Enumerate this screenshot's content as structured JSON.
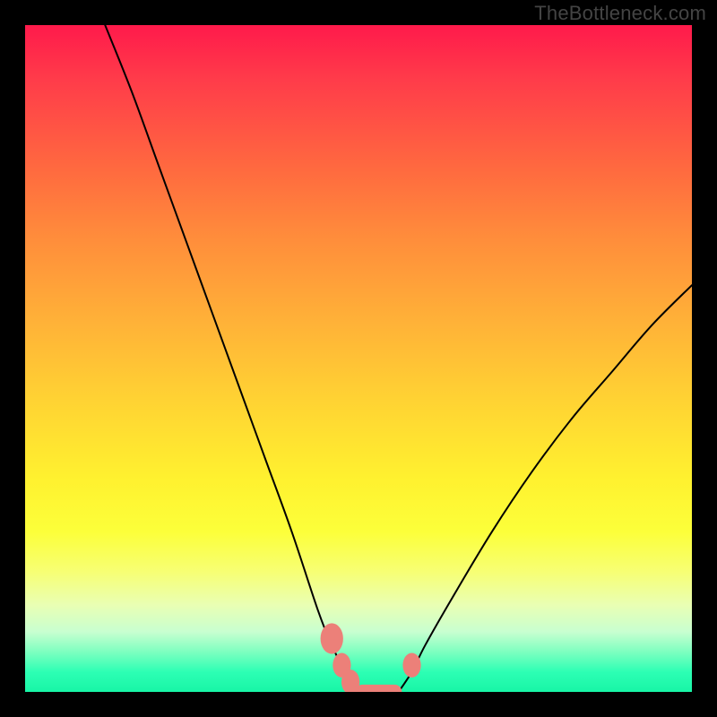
{
  "watermark": "TheBottleneck.com",
  "chart_data": {
    "type": "line",
    "title": "",
    "xlabel": "",
    "ylabel": "",
    "xlim": [
      0,
      100
    ],
    "ylim": [
      0,
      100
    ],
    "grid": false,
    "series": [
      {
        "name": "left-curve",
        "stroke": "#000000",
        "x": [
          12,
          16,
          20,
          24,
          28,
          32,
          36,
          40,
          44,
          46,
          48,
          50
        ],
        "y": [
          100,
          90,
          79,
          68,
          57,
          46,
          35,
          24,
          12,
          7,
          3,
          0
        ]
      },
      {
        "name": "right-curve",
        "stroke": "#000000",
        "x": [
          56,
          58,
          60,
          64,
          70,
          76,
          82,
          88,
          94,
          100
        ],
        "y": [
          0,
          3,
          7,
          14,
          24,
          33,
          41,
          48,
          55,
          61
        ]
      },
      {
        "name": "bottom-flat",
        "stroke": "#000000",
        "x": [
          50,
          56
        ],
        "y": [
          0,
          0
        ]
      }
    ],
    "markers": [
      {
        "name": "marker-left-upper",
        "x": 46.0,
        "y": 8.0,
        "r": 2.0,
        "color": "#ec8079"
      },
      {
        "name": "marker-left-mid",
        "x": 47.5,
        "y": 4.0,
        "r": 1.6,
        "color": "#ec8079"
      },
      {
        "name": "marker-left-lower",
        "x": 48.8,
        "y": 1.5,
        "r": 1.6,
        "color": "#ec8079"
      },
      {
        "name": "marker-right-small",
        "x": 58.0,
        "y": 4.0,
        "r": 1.6,
        "color": "#ec8079"
      }
    ],
    "valley_bar": {
      "name": "valley-bar",
      "x1": 49.5,
      "x2": 56.5,
      "y": 0.0,
      "thickness": 2.2,
      "color": "#ec8079"
    }
  }
}
